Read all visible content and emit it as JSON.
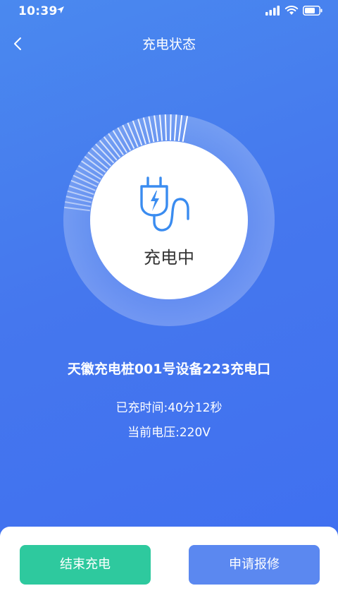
{
  "status_bar": {
    "time": "10:39"
  },
  "header": {
    "title": "充电状态"
  },
  "charging": {
    "status_text": "充电中",
    "progress": 0.27
  },
  "device": {
    "name": "天徽充电桩001号设备223充电口",
    "elapsed_label": "已充时间:40分12秒",
    "voltage_label": "当前电压:220V"
  },
  "actions": {
    "end_label": "结束充电",
    "repair_label": "申请报修"
  },
  "colors": {
    "background_top": "#4a89ef",
    "background_bottom": "#3f6ff0",
    "end_button": "#2ec99e",
    "repair_button": "#5b88f0",
    "plug_icon": "#3a8cf0",
    "status_text": "#333333"
  }
}
